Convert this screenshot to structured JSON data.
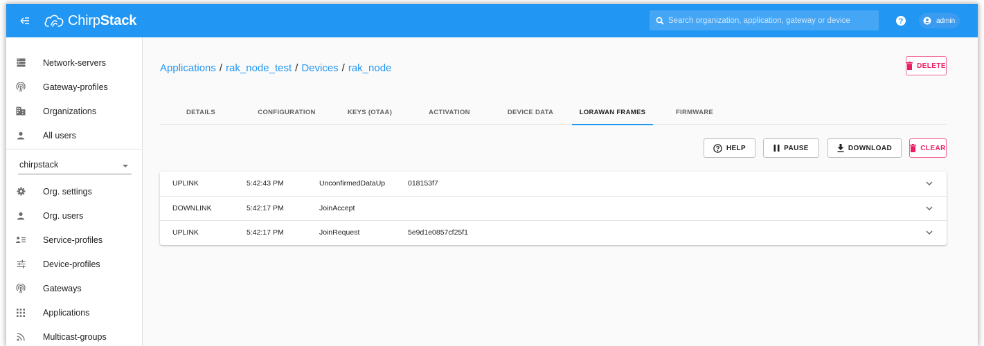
{
  "app": {
    "brand_light": "Chirp",
    "brand_bold": "Stack"
  },
  "colors": {
    "primary": "#2196f3",
    "danger": "#e91e63"
  },
  "search": {
    "placeholder": "Search organization, application, gateway or device",
    "icon": "search-icon"
  },
  "user": {
    "name": "admin",
    "icon": "account-circle-icon"
  },
  "sidebar": {
    "top_items": [
      {
        "label": "Network-servers",
        "icon": "server-icon"
      },
      {
        "label": "Gateway-profiles",
        "icon": "radio-tower-icon"
      },
      {
        "label": "Organizations",
        "icon": "domain-icon"
      },
      {
        "label": "All users",
        "icon": "user-icon"
      }
    ],
    "org_selector": {
      "value": "chirpstack"
    },
    "org_items": [
      {
        "label": "Org. settings",
        "icon": "gear-icon"
      },
      {
        "label": "Org. users",
        "icon": "user-icon"
      },
      {
        "label": "Service-profiles",
        "icon": "account-details-icon"
      },
      {
        "label": "Device-profiles",
        "icon": "tune-icon"
      },
      {
        "label": "Gateways",
        "icon": "radio-tower-icon"
      },
      {
        "label": "Applications",
        "icon": "apps-grid-icon"
      },
      {
        "label": "Multicast-groups",
        "icon": "rss-icon"
      }
    ]
  },
  "breadcrumb": {
    "items": [
      "Applications",
      "rak_node_test",
      "Devices",
      "rak_node"
    ],
    "separator": "/"
  },
  "actions": {
    "delete": "DELETE",
    "help": "HELP",
    "pause": "PAUSE",
    "download": "DOWNLOAD",
    "clear": "CLEAR"
  },
  "tabs": [
    {
      "label": "DETAILS"
    },
    {
      "label": "CONFIGURATION"
    },
    {
      "label": "KEYS (OTAA)"
    },
    {
      "label": "ACTIVATION"
    },
    {
      "label": "DEVICE DATA"
    },
    {
      "label": "LORAWAN FRAMES",
      "active": true
    },
    {
      "label": "FIRMWARE"
    }
  ],
  "frames": [
    {
      "direction": "UPLINK",
      "time": "5:42:43 PM",
      "type": "UnconfirmedDataUp",
      "id": "018153f7"
    },
    {
      "direction": "DOWNLINK",
      "time": "5:42:17 PM",
      "type": "JoinAccept",
      "id": ""
    },
    {
      "direction": "UPLINK",
      "time": "5:42:17 PM",
      "type": "JoinRequest",
      "id": "5e9d1e0857cf25f1"
    }
  ]
}
